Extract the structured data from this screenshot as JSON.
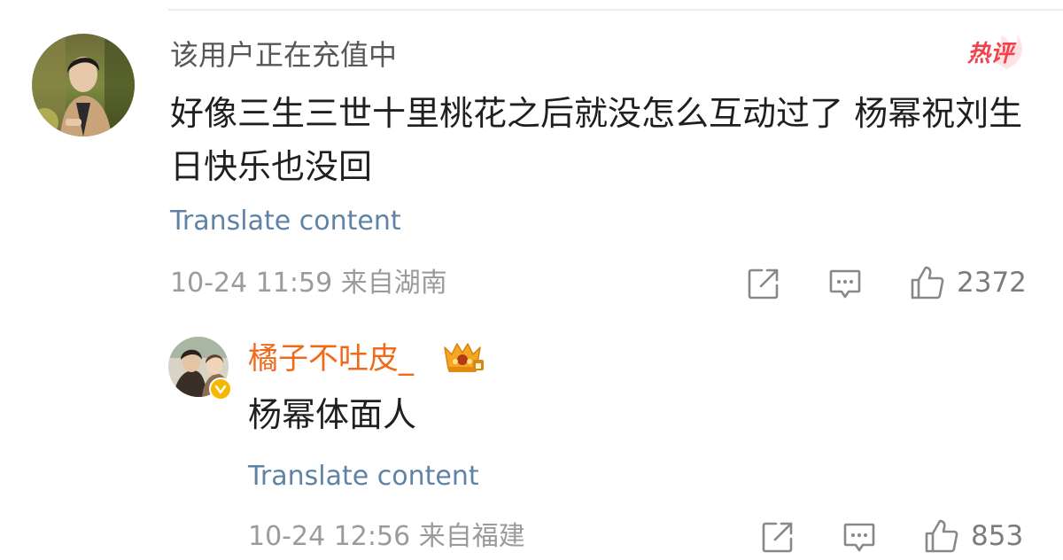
{
  "comment": {
    "username": "该用户正在充值中",
    "hot_badge": "热评",
    "content": "好像三生三世十里桃花之后就没怎么互动过了  杨幂祝刘生日快乐也没回",
    "translate_label": "Translate content",
    "time": "10-24 11:59",
    "location": "来自湖南",
    "like_count": "2372",
    "avatar_icon": "user-avatar",
    "accent_color": "#5f83a6"
  },
  "reply": {
    "username": "橘子不吐皮_",
    "content": "杨幂体面人",
    "translate_label": "Translate content",
    "time": "10-24 12:56",
    "location": "来自福建",
    "like_count": "853",
    "name_color": "#f16a1b",
    "badge_icon": "crown-badge-icon",
    "verified_icon": "verified-badge-icon"
  }
}
